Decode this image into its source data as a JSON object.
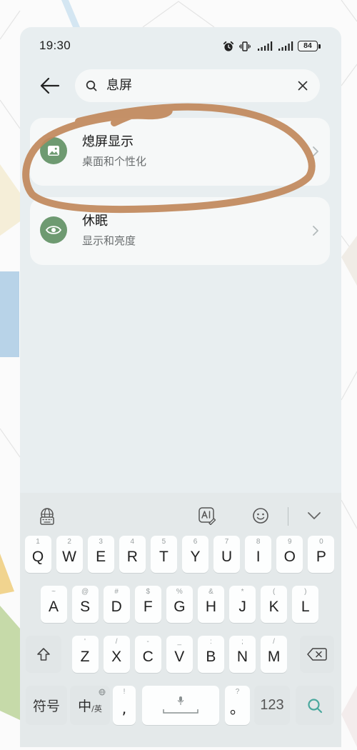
{
  "colors": {
    "screen_bg": "#e8eef0",
    "card_bg": "#f6f8f8",
    "icon_green": "#6e9a71",
    "annotation": "#c1895d",
    "search_key": "#4aa89e"
  },
  "status_bar": {
    "time": "19:30",
    "battery_level": "84",
    "icons": [
      "alarm-icon",
      "vibrate-icon",
      "signal-icon",
      "signal-icon",
      "battery-icon"
    ]
  },
  "search": {
    "back_icon": "back-arrow-icon",
    "search_icon": "search-icon",
    "query": "息屏",
    "clear_icon": "close-icon"
  },
  "results": [
    {
      "icon": "image-icon",
      "title": "熄屏显示",
      "subtitle": "桌面和个性化"
    },
    {
      "icon": "eye-icon",
      "title": "休眠",
      "subtitle": "显示和亮度"
    }
  ],
  "keyboard": {
    "toolbar": [
      "keyboard-settings-icon",
      "ai-writing-icon",
      "emoji-icon",
      "collapse-keyboard-icon"
    ],
    "row1": [
      {
        "label": "Q",
        "hint": "1"
      },
      {
        "label": "W",
        "hint": "2"
      },
      {
        "label": "E",
        "hint": "3"
      },
      {
        "label": "R",
        "hint": "4"
      },
      {
        "label": "T",
        "hint": "5"
      },
      {
        "label": "Y",
        "hint": "6"
      },
      {
        "label": "U",
        "hint": "7"
      },
      {
        "label": "I",
        "hint": "8"
      },
      {
        "label": "O",
        "hint": "9"
      },
      {
        "label": "P",
        "hint": "0"
      }
    ],
    "row2": [
      {
        "label": "A",
        "hint": "~"
      },
      {
        "label": "S",
        "hint": "@"
      },
      {
        "label": "D",
        "hint": "#"
      },
      {
        "label": "F",
        "hint": "$"
      },
      {
        "label": "G",
        "hint": "%"
      },
      {
        "label": "H",
        "hint": "&"
      },
      {
        "label": "J",
        "hint": "*"
      },
      {
        "label": "K",
        "hint": "("
      },
      {
        "label": "L",
        "hint": ")"
      }
    ],
    "row3": [
      {
        "label": "Z",
        "hint": "'"
      },
      {
        "label": "X",
        "hint": "/"
      },
      {
        "label": "C",
        "hint": "-"
      },
      {
        "label": "V",
        "hint": "_"
      },
      {
        "label": "B",
        "hint": ":"
      },
      {
        "label": "N",
        "hint": ";"
      },
      {
        "label": "M",
        "hint": "/"
      }
    ],
    "shift_icon": "shift-icon",
    "backspace_icon": "backspace-icon",
    "symbols": "符号",
    "lang_primary": "中",
    "lang_secondary": "/英",
    "comma": ",",
    "comma_hint": "!",
    "space_icon": "microphone-icon",
    "period": "。",
    "period_hint": "?",
    "numbers": "123",
    "enter_icon": "search-icon"
  }
}
